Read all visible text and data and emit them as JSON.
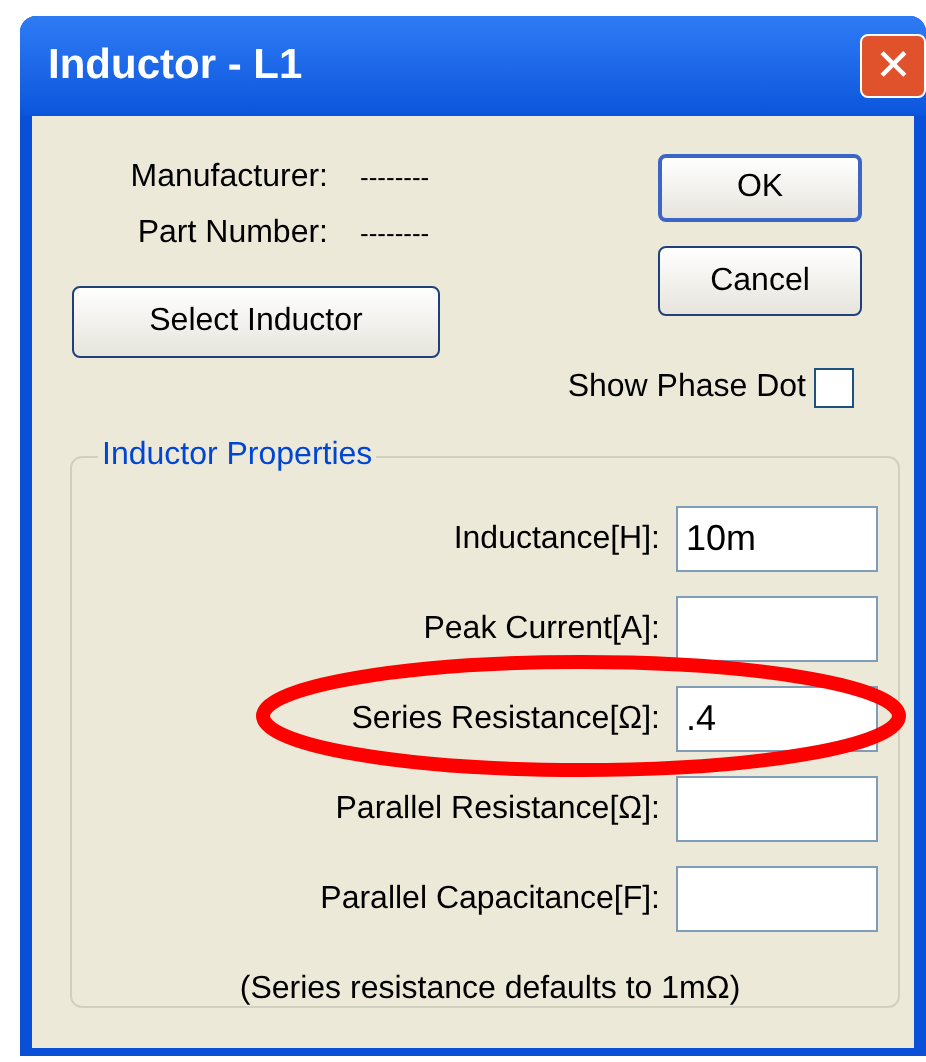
{
  "window": {
    "title": "Inductor - L1",
    "close": "✕"
  },
  "info": [
    {
      "label": "Manufacturer:",
      "value": "--------"
    },
    {
      "label": "Part Number:",
      "value": "--------"
    }
  ],
  "buttons": {
    "ok": "OK",
    "cancel": "Cancel",
    "select": "Select Inductor"
  },
  "show_phase_dot": {
    "label": "Show Phase Dot",
    "checked": false
  },
  "group": {
    "title": "Inductor Properties",
    "fields": [
      {
        "label": "Inductance[H]:",
        "value": "10m",
        "highlighted": false
      },
      {
        "label": "Peak Current[A]:",
        "highlighted": false
      },
      {
        "label": "Series Resistance[Ω]:",
        "value": ".4",
        "highlighted": true
      },
      {
        "label": "Parallel Resistance[Ω]:",
        "highlighted": false
      },
      {
        "label": "Parallel Capacitance[F]:",
        "highlighted": false
      }
    ],
    "note": "(Series resistance defaults to 1mΩ)"
  }
}
